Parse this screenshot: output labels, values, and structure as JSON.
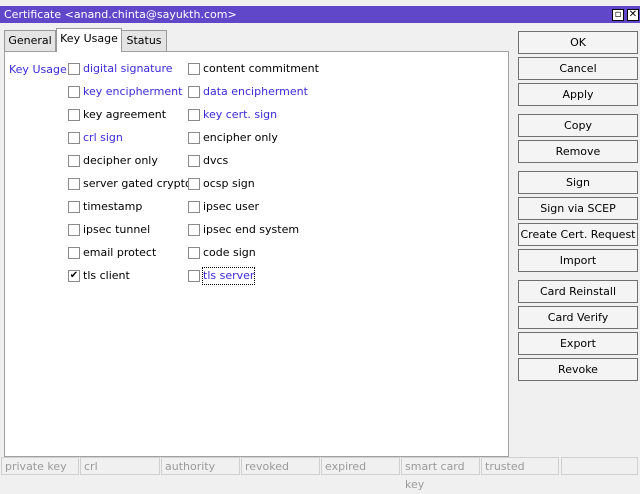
{
  "window": {
    "title": "Certificate <anand.chinta@sayukth.com>"
  },
  "tabs": [
    "General",
    "Key Usage",
    "Status"
  ],
  "key_usage_label": "Key Usage:",
  "options_left": [
    {
      "label": "digital signature",
      "checked": false,
      "color": "#3a2ad8"
    },
    {
      "label": "key encipherment",
      "checked": false,
      "color": "#3a2ad8"
    },
    {
      "label": "key agreement",
      "checked": false,
      "color": "#000000"
    },
    {
      "label": "crl sign",
      "checked": false,
      "color": "#3a2ad8"
    },
    {
      "label": "decipher only",
      "checked": false,
      "color": "#000000"
    },
    {
      "label": "server gated crypto",
      "checked": false,
      "color": "#000000"
    },
    {
      "label": "timestamp",
      "checked": false,
      "color": "#000000"
    },
    {
      "label": "ipsec tunnel",
      "checked": false,
      "color": "#000000"
    },
    {
      "label": "email protect",
      "checked": false,
      "color": "#000000"
    },
    {
      "label": "tls client",
      "checked": true,
      "color": "#000000"
    }
  ],
  "options_right": [
    {
      "label": "content commitment",
      "checked": false,
      "color": "#000000"
    },
    {
      "label": "data encipherment",
      "checked": false,
      "color": "#3a2ad8"
    },
    {
      "label": "key cert. sign",
      "checked": false,
      "color": "#3a2ad8"
    },
    {
      "label": "encipher only",
      "checked": false,
      "color": "#000000"
    },
    {
      "label": "dvcs",
      "checked": false,
      "color": "#000000"
    },
    {
      "label": "ocsp sign",
      "checked": false,
      "color": "#000000"
    },
    {
      "label": "ipsec user",
      "checked": false,
      "color": "#000000"
    },
    {
      "label": "ipsec end system",
      "checked": false,
      "color": "#000000"
    },
    {
      "label": "code sign",
      "checked": false,
      "color": "#000000"
    },
    {
      "label": "tls server",
      "checked": false,
      "color": "#3a2ad8"
    }
  ],
  "buttons": [
    "OK",
    "Cancel",
    "Apply",
    "Copy",
    "Remove",
    "Sign",
    "Sign via SCEP",
    "Create Cert. Request",
    "Import",
    "Card Reinstall",
    "Card Verify",
    "Export",
    "Revoke"
  ],
  "status_fields": [
    "private key",
    "crl",
    "authority",
    "revoked",
    "expired",
    "smart card key",
    "trusted",
    ""
  ]
}
